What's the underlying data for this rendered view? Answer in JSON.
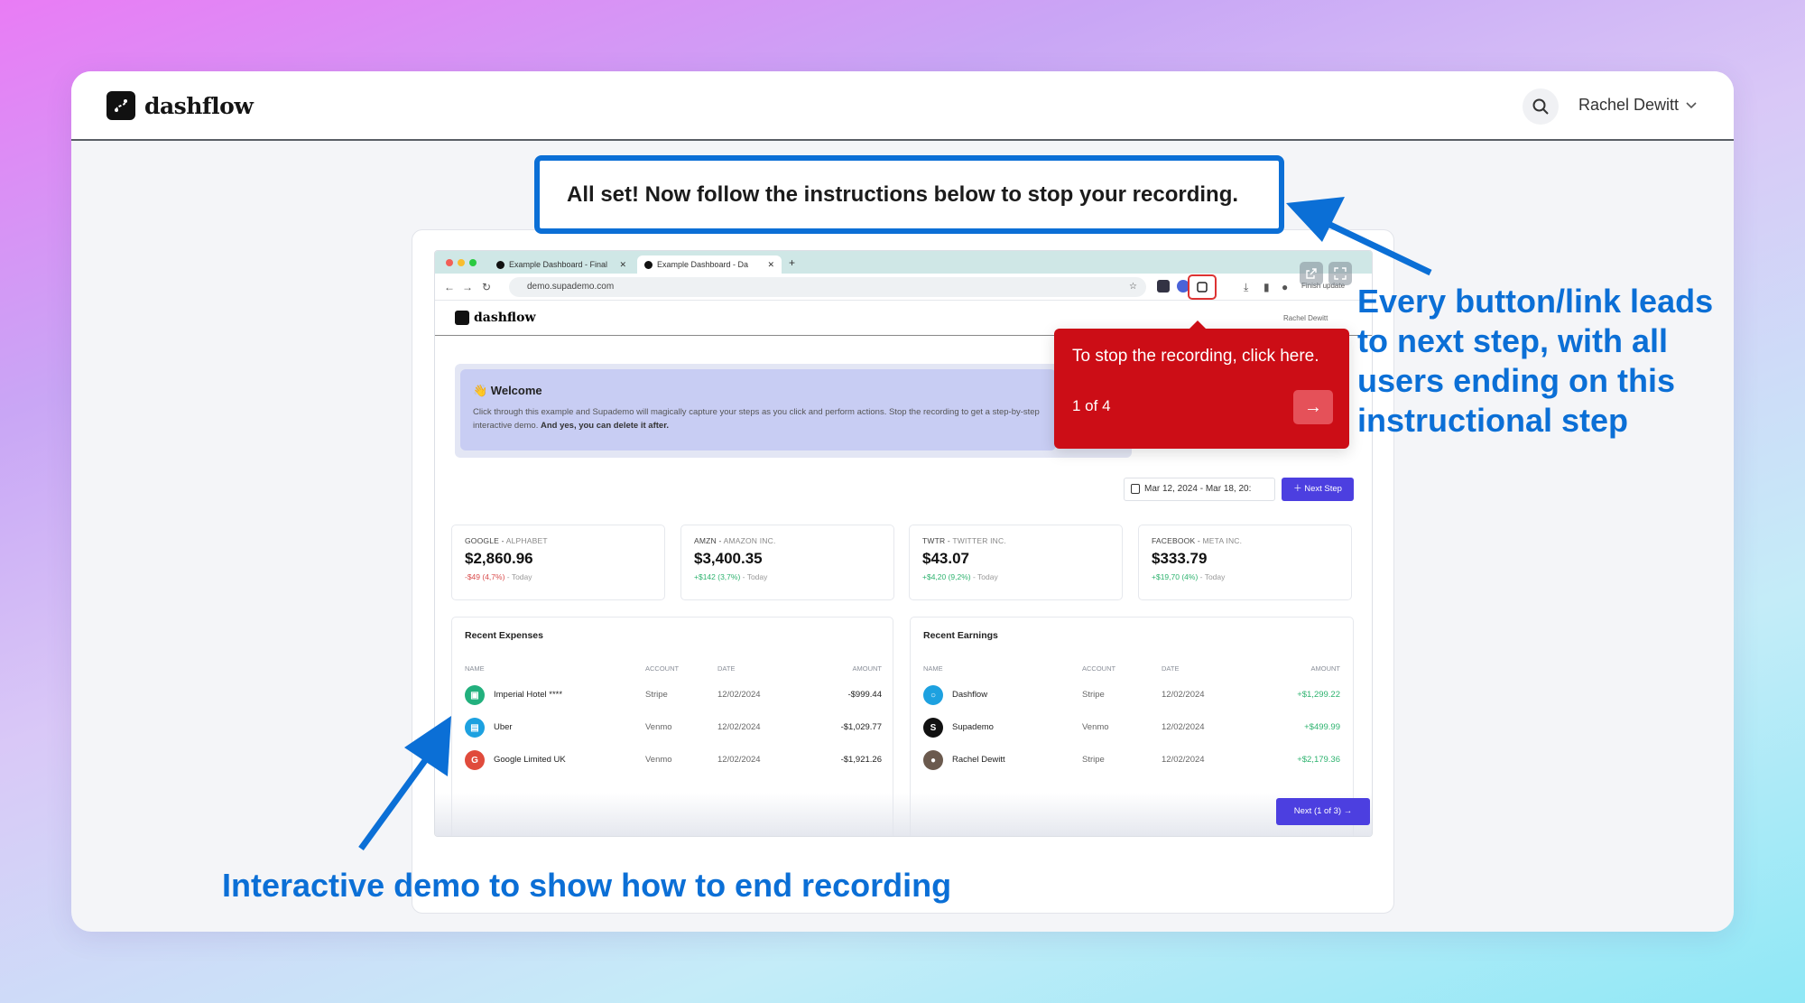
{
  "app": {
    "logo_text": "dashflow",
    "user_name": "Rachel Dewitt"
  },
  "banner": {
    "text": "All set! Now follow the instructions below to stop your recording."
  },
  "browser": {
    "tabs": [
      {
        "label": "Example Dashboard - Final"
      },
      {
        "label": "Example Dashboard - Da"
      }
    ],
    "url": "demo.supademo.com",
    "finish_update": "Finish update"
  },
  "demo_app": {
    "logo_text": "dashflow",
    "user_name": "Rachel Dewitt",
    "welcome": {
      "title": "👋 Welcome",
      "body": "Click through this example and Supademo will magically capture your steps as you click and perform actions. Stop the recording to get a step-by-step interactive demo.",
      "body_bold": "And yes, you can delete it after."
    },
    "date_range": "Mar 12, 2024 - Mar 18, 20:",
    "next_step_label": "Next Step",
    "stocks": [
      {
        "symbol": "GOOGLE",
        "name": "ALPHABET",
        "price": "$2,860.96",
        "change": "-$49 (4,7%)",
        "period": "Today",
        "direction": "neg"
      },
      {
        "symbol": "AMZN",
        "name": "AMAZON INC.",
        "price": "$3,400.35",
        "change": "+$142 (3,7%)",
        "period": "Today",
        "direction": "pos"
      },
      {
        "symbol": "TWTR",
        "name": "TWITTER INC.",
        "price": "$43.07",
        "change": "+$4,20 (9,2%)",
        "period": "Today",
        "direction": "pos"
      },
      {
        "symbol": "FACEBOOK",
        "name": "META INC.",
        "price": "$333.79",
        "change": "+$19,70 (4%)",
        "period": "Today",
        "direction": "pos"
      }
    ],
    "expenses": {
      "title": "Recent Expenses",
      "columns": [
        "NAME",
        "ACCOUNT",
        "DATE",
        "AMOUNT"
      ],
      "rows": [
        {
          "name": "Imperial Hotel ****",
          "account": "Stripe",
          "date": "12/02/2024",
          "amount": "-$999.44",
          "icon": "hotel-icon",
          "color": "#22b07d"
        },
        {
          "name": "Uber",
          "account": "Venmo",
          "date": "12/02/2024",
          "amount": "-$1,029.77",
          "icon": "car-icon",
          "color": "#1da1e0"
        },
        {
          "name": "Google Limited UK",
          "account": "Venmo",
          "date": "12/02/2024",
          "amount": "-$1,921.26",
          "icon": "google-icon",
          "color": "#e04b3c",
          "letter": "G"
        }
      ]
    },
    "earnings": {
      "title": "Recent Earnings",
      "columns": [
        "NAME",
        "ACCOUNT",
        "DATE",
        "AMOUNT"
      ],
      "rows": [
        {
          "name": "Dashflow",
          "account": "Stripe",
          "date": "12/02/2024",
          "amount": "+$1,299.22",
          "icon": "dashflow-icon",
          "color": "#1da1e0"
        },
        {
          "name": "Supademo",
          "account": "Venmo",
          "date": "12/02/2024",
          "amount": "+$499.99",
          "icon": "supademo-icon",
          "color": "#111111",
          "letter": "S"
        },
        {
          "name": "Rachel Dewitt",
          "account": "Stripe",
          "date": "12/02/2024",
          "amount": "+$2,179.36",
          "icon": "avatar-icon",
          "color": "#6b5a4e"
        }
      ]
    },
    "next_of_label": "Next (1 of 3) →"
  },
  "tooltip": {
    "text": "To stop the recording, click here.",
    "step": "1 of 4"
  },
  "annotations": {
    "right": "Every button/link leads to next step, with all users ending on this instructional step",
    "bottom": "Interactive demo to show how to end recording"
  },
  "colors": {
    "accent_blue": "#0b6fd6",
    "tooltip_red": "#cc0d16",
    "primary_purple": "#4c3fe0"
  }
}
